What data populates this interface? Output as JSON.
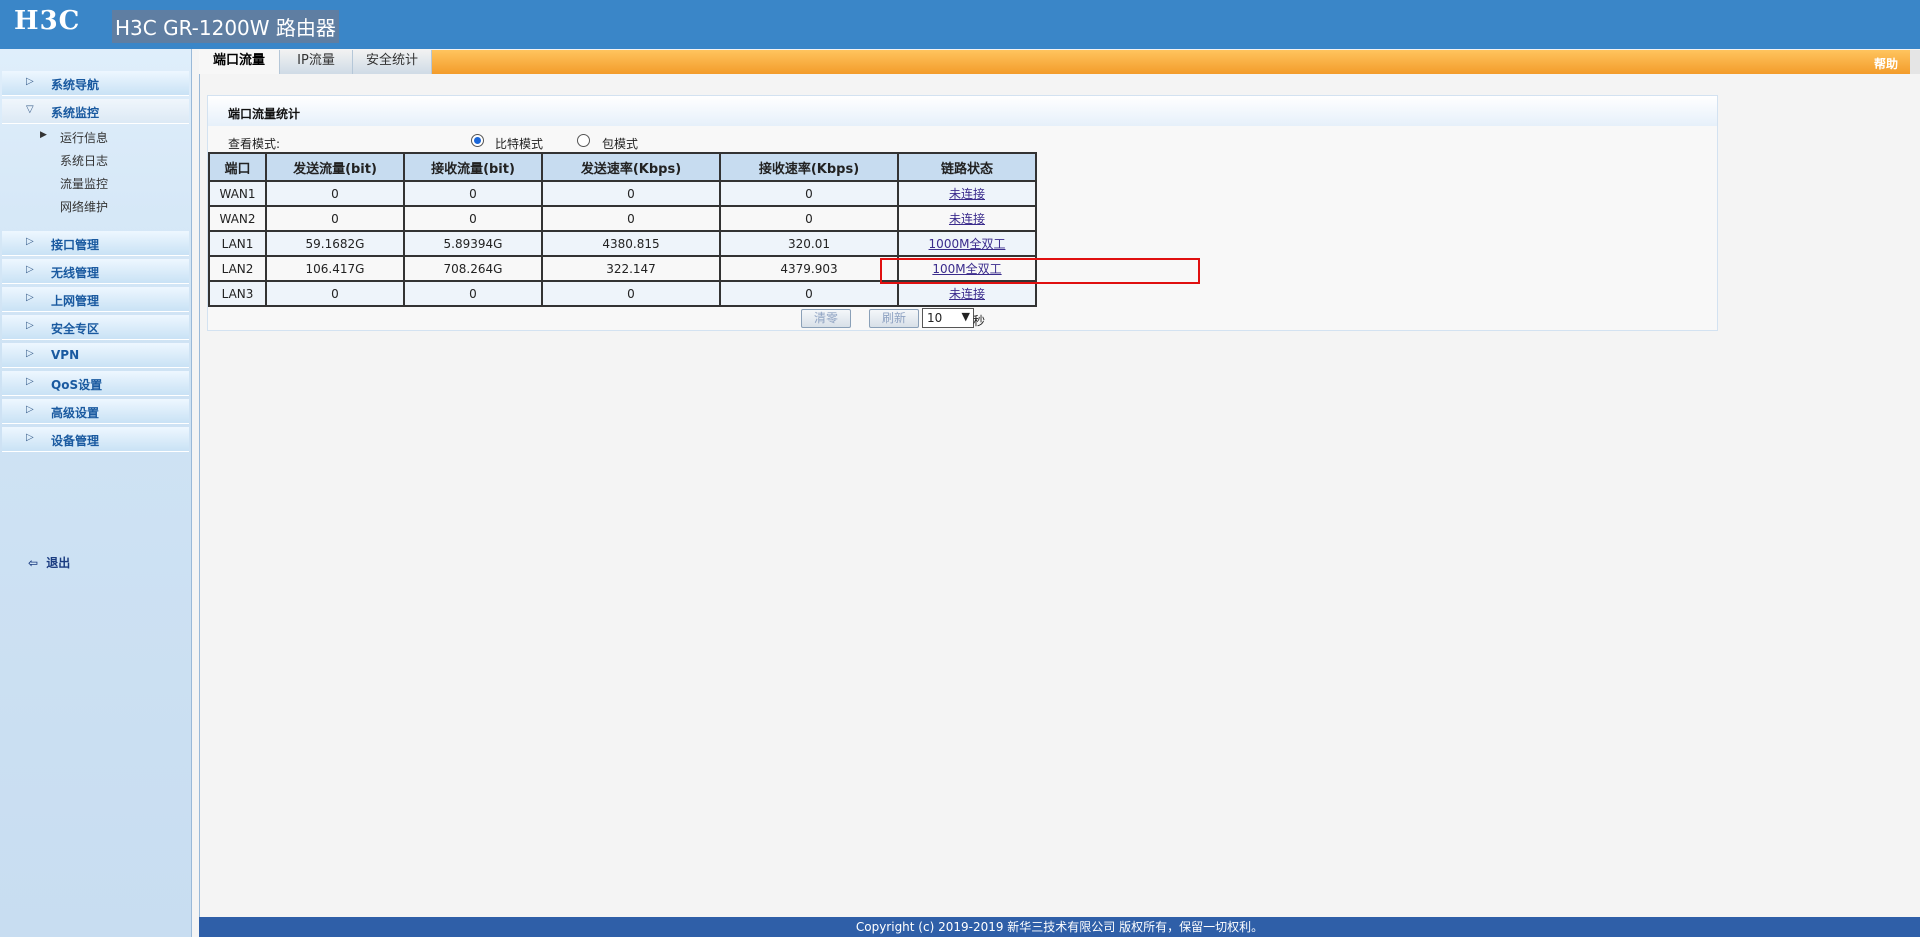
{
  "header": {
    "logo": "H3C",
    "device_title": "H3C GR-1200W 路由器"
  },
  "sidebar": {
    "items": [
      {
        "label": "系统导航"
      },
      {
        "label": "系统监控"
      },
      {
        "label": "接口管理"
      },
      {
        "label": "无线管理"
      },
      {
        "label": "上网管理"
      },
      {
        "label": "安全专区"
      },
      {
        "label": "VPN"
      },
      {
        "label": "QoS设置"
      },
      {
        "label": "高级设置"
      },
      {
        "label": "设备管理"
      }
    ],
    "sub_items": [
      {
        "label": "运行信息"
      },
      {
        "label": "系统日志"
      },
      {
        "label": "流量监控"
      },
      {
        "label": "网络维护"
      }
    ],
    "logout": "退出"
  },
  "tabs": [
    {
      "label": "端口流量"
    },
    {
      "label": "IP流量"
    },
    {
      "label": "安全统计"
    }
  ],
  "help": "帮助",
  "panel": {
    "title": "端口流量统计",
    "view_mode_label": "查看模式:",
    "modes": [
      {
        "label": "比特模式",
        "checked": true
      },
      {
        "label": "包模式",
        "checked": false
      }
    ]
  },
  "table": {
    "columns": [
      "端口",
      "发送流量(bit)",
      "接收流量(bit)",
      "发送速率(Kbps)",
      "接收速率(Kbps)",
      "链路状态"
    ],
    "rows": [
      {
        "port": "WAN1",
        "tx": "0",
        "rx": "0",
        "tx_rate": "0",
        "rx_rate": "0",
        "status": "未连接"
      },
      {
        "port": "WAN2",
        "tx": "0",
        "rx": "0",
        "tx_rate": "0",
        "rx_rate": "0",
        "status": "未连接"
      },
      {
        "port": "LAN1",
        "tx": "59.1682G",
        "rx": "5.89394G",
        "tx_rate": "4380.815",
        "rx_rate": "320.01",
        "status": "1000M全双工"
      },
      {
        "port": "LAN2",
        "tx": "106.417G",
        "rx": "708.264G",
        "tx_rate": "322.147",
        "rx_rate": "4379.903",
        "status": "100M全双工"
      },
      {
        "port": "LAN3",
        "tx": "0",
        "rx": "0",
        "tx_rate": "0",
        "rx_rate": "0",
        "status": "未连接"
      }
    ]
  },
  "controls": {
    "clear": "清零",
    "refresh": "刷新",
    "interval": "10",
    "unit": "秒"
  },
  "footer": "Copyright (c) 2019-2019 新华三技术有限公司 版权所有，保留一切权利。",
  "colors": {
    "header": "#3a86c8",
    "tabbar": "#f39c2b",
    "highlight": "#e01010",
    "footer": "#2f5fa8"
  }
}
